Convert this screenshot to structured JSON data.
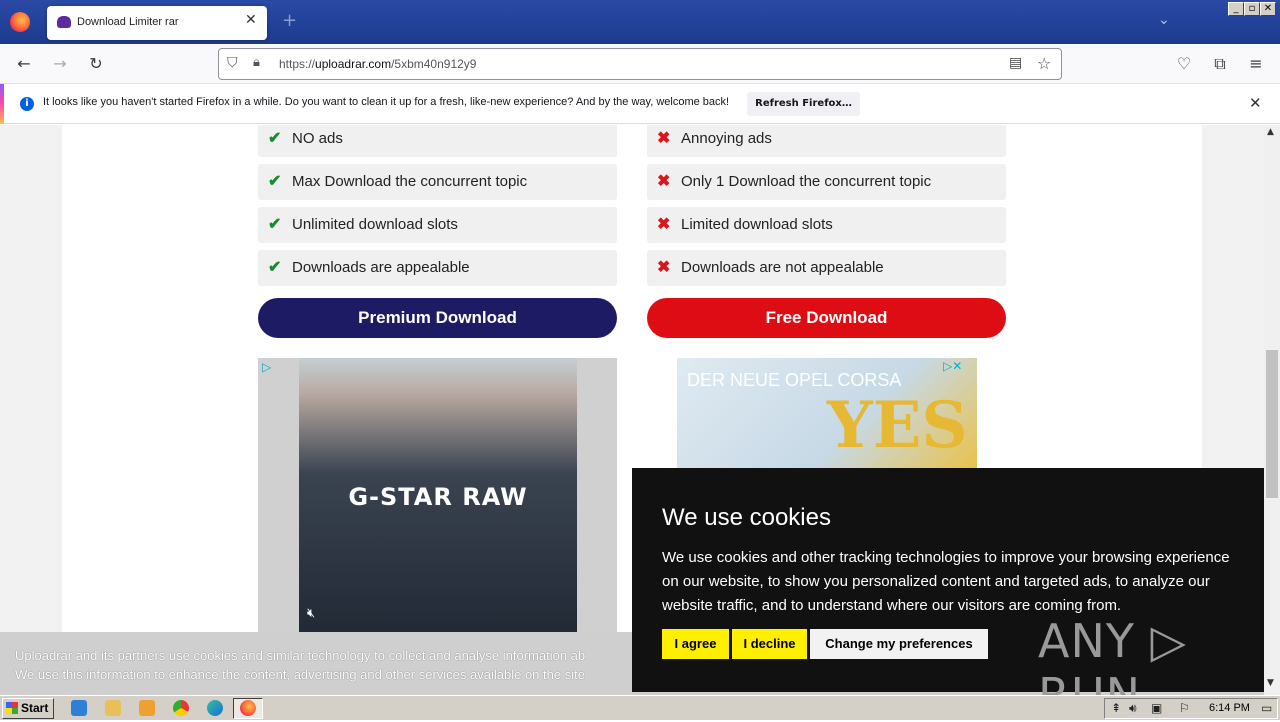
{
  "browser": {
    "tab_title": "Download Limiter rar",
    "tab_close": "✕",
    "new_tab": "+",
    "tabs_menu": "⌄",
    "window_buttons": [
      "_",
      "▫",
      "✕"
    ],
    "url_host": "uploadrar.com",
    "url_prefix": "https://",
    "url_path": "/5xbm40n912y9",
    "notification_text": "It looks like you haven't started Firefox in a while. Do you want to clean it up for a fresh, like-new experience? And by the way, welcome back!",
    "notification_button": "Refresh Firefox…"
  },
  "premium_features": [
    "NO ads",
    "Max Download the concurrent topic",
    "Unlimited download slots",
    "Downloads are appealable"
  ],
  "free_features": [
    "Annoying ads",
    "Only 1 Download the concurrent topic",
    "Limited download slots",
    "Downloads are not appealable"
  ],
  "buttons": {
    "premium": "Premium Download",
    "free": "Free Download"
  },
  "ads": {
    "left_brand": "G-STAR RAW",
    "right_title": "DER NEUE OPEL CORSA",
    "right_art": "YES"
  },
  "consent_strip": {
    "line1": "Uploadrar and its partners use cookies and similar technology to collect and analyse information ab",
    "line2": "We use this information to enhance the content, advertising and other services available on the site"
  },
  "cookie_popup": {
    "title": "We use cookies",
    "body": "We use cookies and other tracking technologies to improve your browsing experience on our website, to show you personalized content and targeted ads, to analyze our website traffic, and to understand where our visitors are coming from.",
    "agree": "I agree",
    "decline": "I decline",
    "preferences": "Change my preferences"
  },
  "watermark": "ANY ▷ RUN",
  "taskbar": {
    "start": "Start",
    "clock": "6:14 PM"
  },
  "colors": {
    "premium": "#1d1b63",
    "free": "#de0d14",
    "check": "#1a8a2a",
    "cross": "#d8161c",
    "cookie_button": "#ffef00"
  }
}
